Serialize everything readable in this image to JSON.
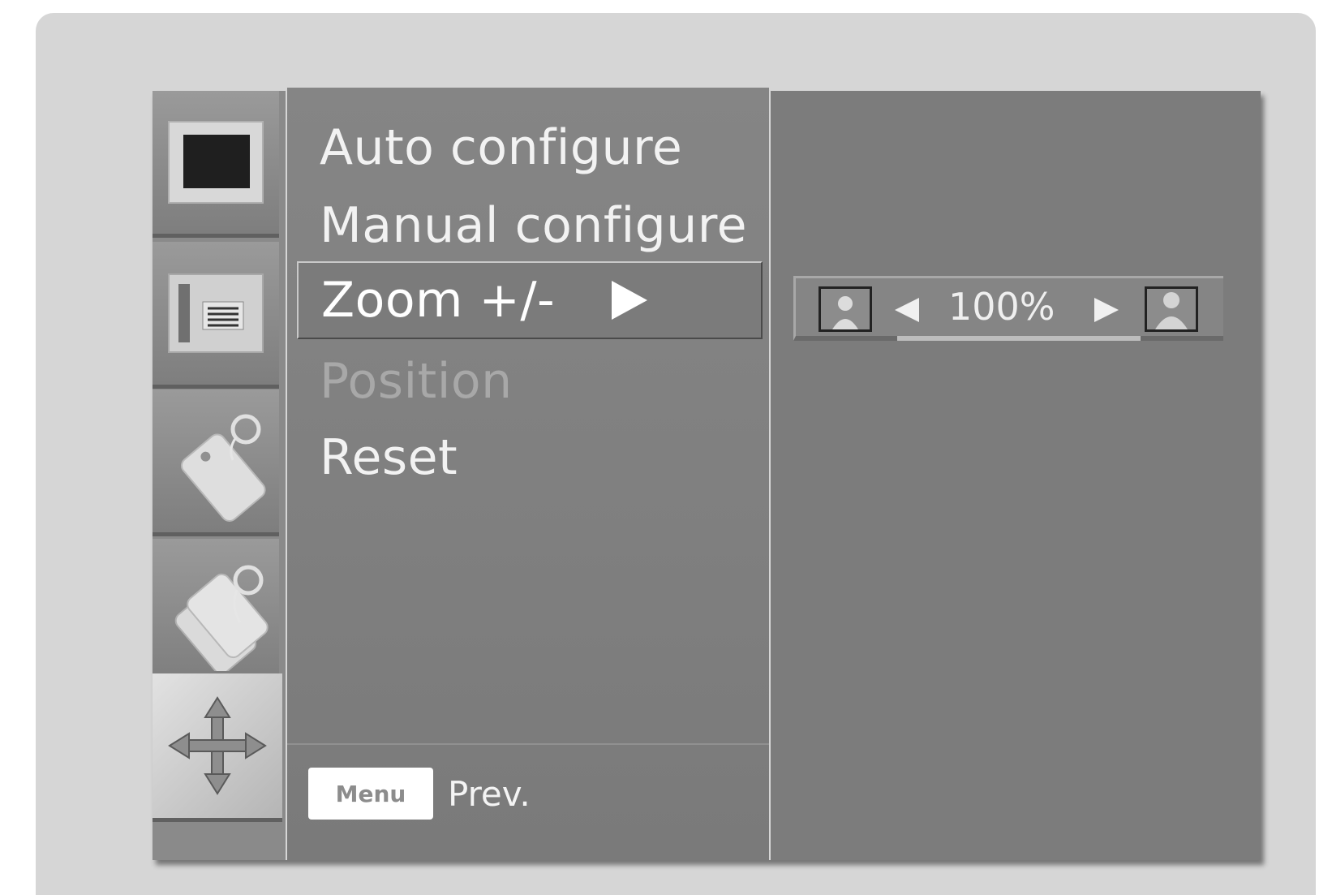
{
  "menu": {
    "items": [
      {
        "label": "Auto configure",
        "state": "normal"
      },
      {
        "label": "Manual configure",
        "state": "normal"
      },
      {
        "label": "Zoom +/-",
        "state": "selected"
      },
      {
        "label": "Position",
        "state": "disabled"
      },
      {
        "label": "Reset",
        "state": "normal"
      }
    ],
    "footer": {
      "key_label": "Menu",
      "prev_label": "Prev."
    }
  },
  "zoom": {
    "value": "100%"
  },
  "sidebar": {
    "icons": [
      "picture-icon",
      "screen-icon",
      "tag-icon",
      "tags-icon",
      "move-arrows-icon"
    ],
    "active": "move-arrows-icon"
  },
  "colors": {
    "menu_bg": "#808080",
    "panel_bg": "#7c7c7c",
    "frame_bg": "#d6d6d6",
    "text": "#f2f2f2",
    "disabled_text": "#a8a8a8"
  }
}
